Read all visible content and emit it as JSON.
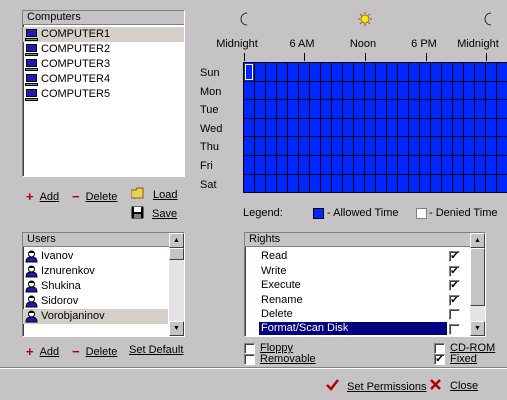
{
  "computers": {
    "header": "Computers",
    "items": [
      "COMPUTER1",
      "COMPUTER2",
      "COMPUTER3",
      "COMPUTER4",
      "COMPUTER5"
    ],
    "selected": 0,
    "add_label": "Add",
    "delete_label": "Delete",
    "load_label": "Load",
    "save_label": "Save"
  },
  "schedule": {
    "hours": [
      "Midnight",
      "6 AM",
      "Noon",
      "6 PM",
      "Midnight"
    ],
    "days": [
      "Sun",
      "Mon",
      "Tue",
      "Wed",
      "Thu",
      "Fri",
      "Sat"
    ],
    "legend_label": "Legend:",
    "allowed_label": "- Allowed Time",
    "denied_label": "- Denied Time",
    "allowed_color": "#0026ff",
    "denied_color": "#ffffff"
  },
  "users": {
    "header": "Users",
    "items": [
      "Ivanov",
      "Iznurenkov",
      "Shukina",
      "Sidorov",
      "Vorobjaninov"
    ],
    "selected": 4,
    "add_label": "Add",
    "delete_label": "Delete",
    "set_default_label": "Set Default"
  },
  "rights": {
    "header": "Rights",
    "items": [
      {
        "label": "Read",
        "checked": true
      },
      {
        "label": "Write",
        "checked": true
      },
      {
        "label": "Execute",
        "checked": true
      },
      {
        "label": "Rename",
        "checked": true
      },
      {
        "label": "Delete",
        "checked": false
      },
      {
        "label": "Format/Scan Disk",
        "checked": false
      }
    ],
    "selected": 5
  },
  "drives": {
    "floppy": {
      "label": "Floppy",
      "checked": false
    },
    "removable": {
      "label": "Removable",
      "checked": false
    },
    "cdrom": {
      "label": "CD-ROM",
      "checked": false
    },
    "fixed": {
      "label": "Fixed",
      "checked": true
    }
  },
  "footer": {
    "set_permissions_label": "Set Permissions",
    "close_label": "Close"
  }
}
